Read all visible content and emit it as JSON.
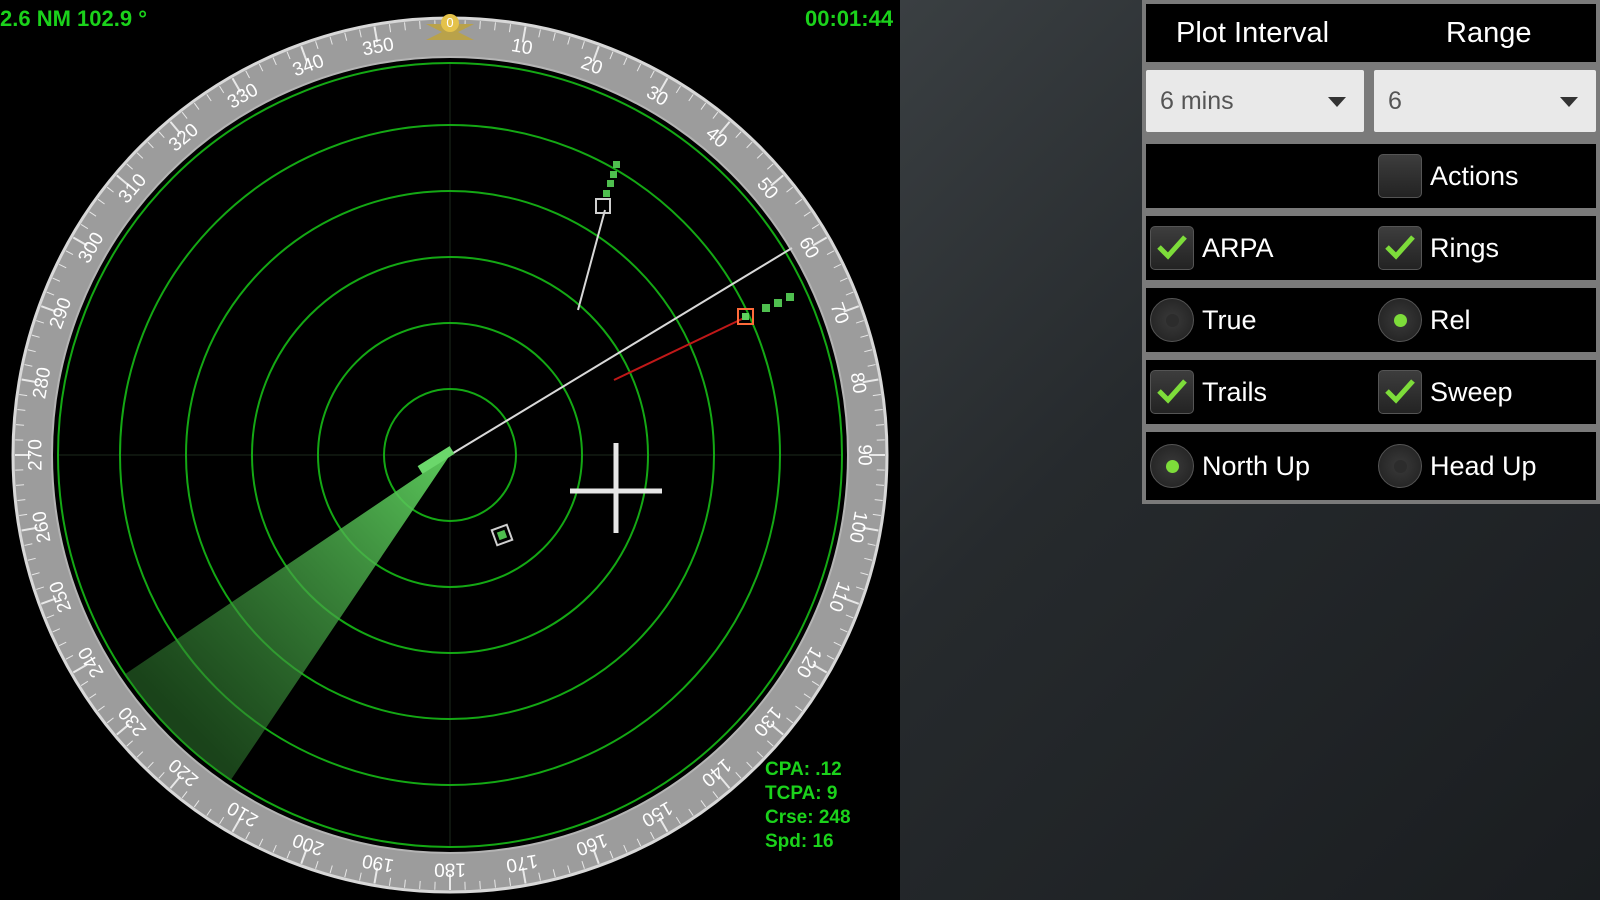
{
  "hud": {
    "range_bearing": "2.6 NM 102.9 °",
    "clock": "00:01:44",
    "target_info": [
      "CPA: .12",
      "TCPA: 9",
      "Crse: 248",
      "Spd: 16"
    ]
  },
  "compass": {
    "labels": [
      "0",
      "10",
      "20",
      "30",
      "40",
      "50",
      "60",
      "70",
      "80",
      "90",
      "100",
      "110",
      "120",
      "130",
      "140",
      "150",
      "160",
      "170",
      "180",
      "190",
      "200",
      "210",
      "220",
      "230",
      "240",
      "250",
      "260",
      "270",
      "280",
      "290",
      "300",
      "310",
      "320",
      "330",
      "340",
      "350"
    ]
  },
  "controls": {
    "plot_interval_header": "Plot Interval",
    "range_header": "Range",
    "plot_interval_value": "6 mins",
    "range_value": "6",
    "actions_label": "Actions",
    "arpa_label": "ARPA",
    "rings_label": "Rings",
    "true_label": "True",
    "rel_label": "Rel",
    "trails_label": "Trails",
    "sweep_label": "Sweep",
    "north_up_label": "North Up",
    "head_up_label": "Head Up"
  },
  "state": {
    "actions_checked": false,
    "arpa_checked": true,
    "rings_checked": true,
    "true_selected": false,
    "rel_selected": true,
    "trails_checked": true,
    "sweep_checked": true,
    "north_up_selected": true,
    "head_up_selected": false
  },
  "colors": {
    "accent_green": "#1bd21b",
    "ring_green": "#14a814",
    "check_green": "#7ddc3a"
  },
  "icons": [
    "chevron-down-icon",
    "checkmark-icon",
    "radio-dot-icon",
    "crosshair-icon",
    "heading-marker-icon"
  ]
}
